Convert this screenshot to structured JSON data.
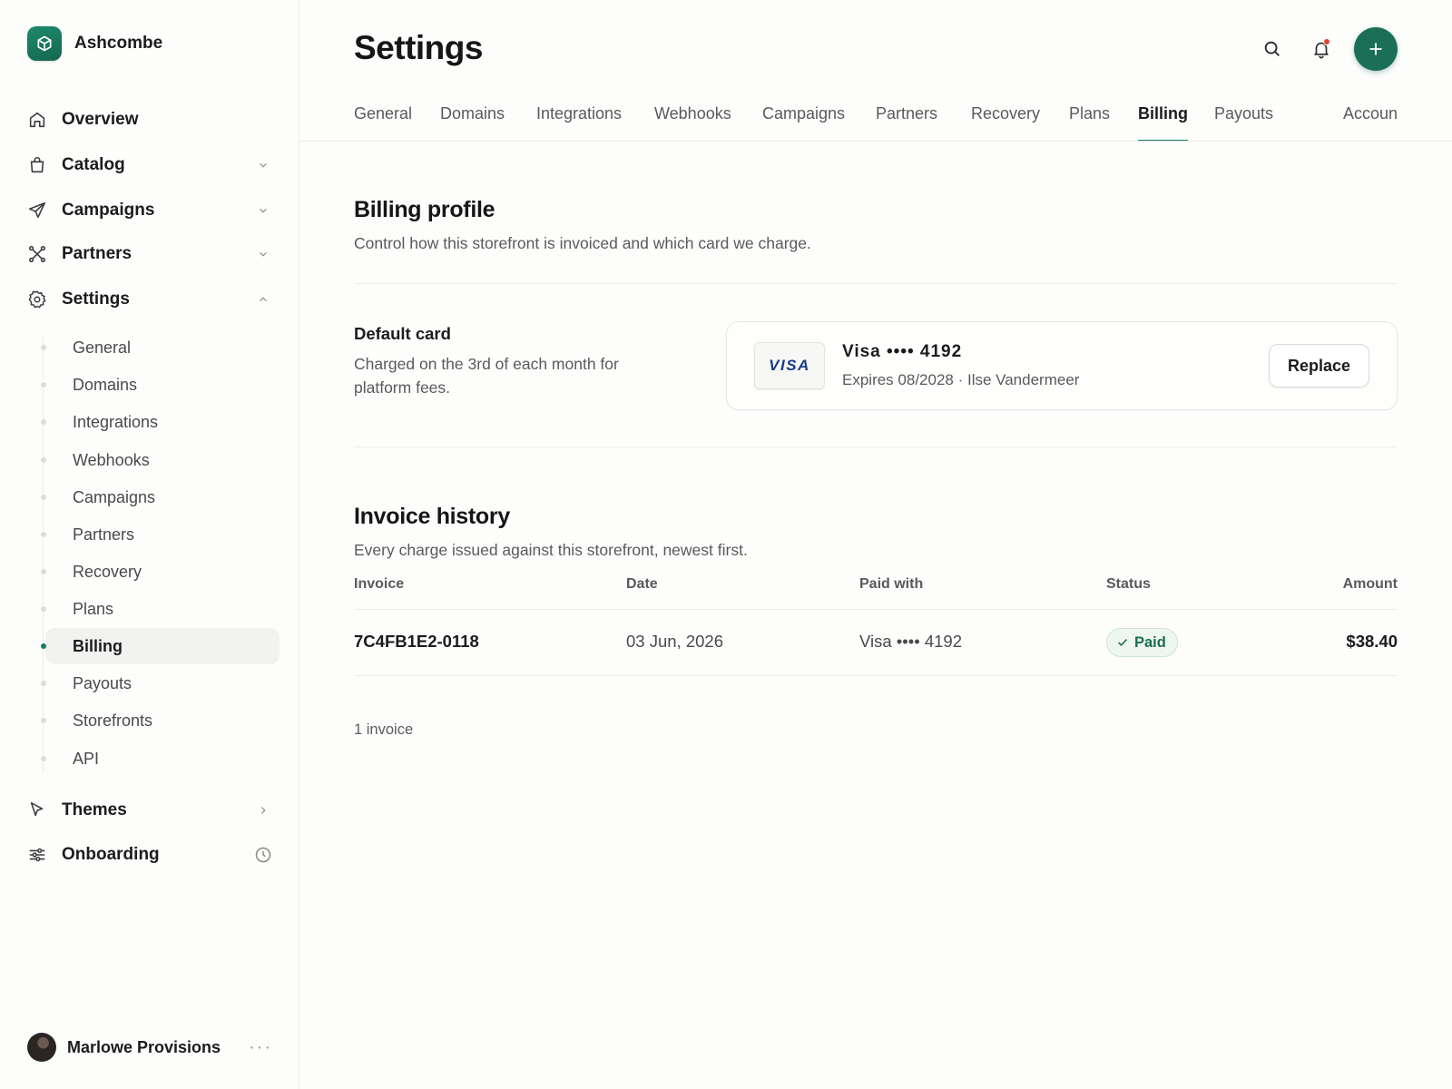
{
  "brand": {
    "name": "Ashcombe"
  },
  "sidebar": {
    "nav": [
      {
        "label": "Overview",
        "icon": "home-icon"
      },
      {
        "label": "Catalog",
        "icon": "shopping-bag-icon"
      },
      {
        "label": "Campaigns",
        "icon": "send-icon"
      },
      {
        "label": "Partners",
        "icon": "network-icon"
      },
      {
        "label": "Settings",
        "icon": "gear-icon"
      },
      {
        "label": "Themes",
        "icon": "cursor-icon"
      },
      {
        "label": "Onboarding",
        "icon": "sliders-icon"
      }
    ],
    "settings_subnav": [
      {
        "label": "General"
      },
      {
        "label": "Domains"
      },
      {
        "label": "Integrations"
      },
      {
        "label": "Webhooks"
      },
      {
        "label": "Campaigns"
      },
      {
        "label": "Partners"
      },
      {
        "label": "Recovery"
      },
      {
        "label": "Plans"
      },
      {
        "label": "Billing",
        "active": true
      },
      {
        "label": "Payouts"
      },
      {
        "label": "Storefronts"
      },
      {
        "label": "API"
      }
    ],
    "user": {
      "name": "Marlowe Provisions",
      "more": "···"
    }
  },
  "header": {
    "title": "Settings"
  },
  "tabs": [
    {
      "label": "General"
    },
    {
      "label": "Domains"
    },
    {
      "label": "Integrations"
    },
    {
      "label": "Webhooks"
    },
    {
      "label": "Campaigns"
    },
    {
      "label": "Partners"
    },
    {
      "label": "Recovery"
    },
    {
      "label": "Plans"
    },
    {
      "label": "Billing",
      "active": true
    },
    {
      "label": "Payouts"
    },
    {
      "label": "Accoun"
    }
  ],
  "billing_profile": {
    "title": "Billing profile",
    "description": "Control how this storefront is invoiced and which card we charge."
  },
  "default_card": {
    "label": "Default card",
    "description": "Charged on the 3rd of each month for platform fees.",
    "brand": "VISA",
    "title": "Visa •••• 4192",
    "subtitle": "Expires 08/2028 · Ilse Vandermeer",
    "replace_label": "Replace"
  },
  "invoice_history": {
    "title": "Invoice history",
    "description": "Every charge issued against this storefront, newest first.",
    "columns": [
      "Invoice",
      "Date",
      "Paid with",
      "Status",
      "Amount"
    ],
    "rows": [
      {
        "invoice": "7C4FB1E2-0118",
        "date": "03 Jun, 2026",
        "paid_with": "Visa •••• 4192",
        "status": "Paid",
        "amount": "$38.40"
      }
    ],
    "count": "1 invoice"
  },
  "colors": {
    "accent": "#1b6f57",
    "paid": "#1b6f4f",
    "notification": "#e0432e"
  }
}
